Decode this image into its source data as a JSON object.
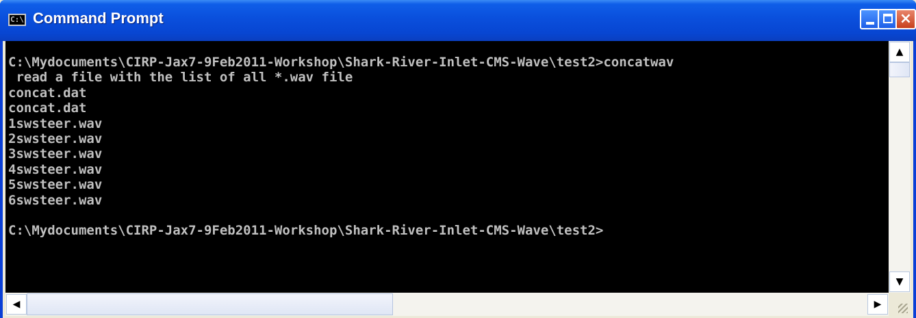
{
  "window": {
    "title": "Command Prompt",
    "icon": "console-icon",
    "icon_label": "C:\\",
    "controls": {
      "minimize": "minimize-icon",
      "maximize": "maximize-icon",
      "close": "close-icon",
      "close_glyph": "×"
    }
  },
  "console": {
    "lines": [
      "C:\\Mydocuments\\CIRP-Jax7-9Feb2011-Workshop\\Shark-River-Inlet-CMS-Wave\\test2>concatwav",
      " read a file with the list of all *.wav file",
      "concat.dat",
      "concat.dat",
      "1swsteer.wav",
      "2swsteer.wav",
      "3swsteer.wav",
      "4swsteer.wav",
      "5swsteer.wav",
      "6swsteer.wav",
      "",
      "C:\\Mydocuments\\CIRP-Jax7-9Feb2011-Workshop\\Shark-River-Inlet-CMS-Wave\\test2>"
    ]
  },
  "scrollbars": {
    "up_glyph": "▲",
    "down_glyph": "▼",
    "left_glyph": "◀",
    "right_glyph": "▶"
  }
}
